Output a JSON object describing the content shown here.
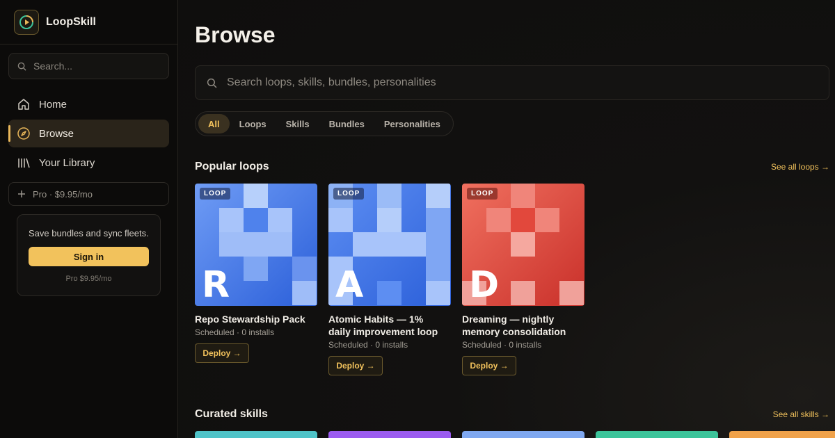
{
  "sidebar": {
    "brand": "LoopSkill",
    "search_placeholder": "Search...",
    "nav": [
      {
        "label": "Home",
        "icon": "home-icon"
      },
      {
        "label": "Browse",
        "icon": "compass-icon",
        "active": true
      },
      {
        "label": "Your Library",
        "icon": "library-icon"
      }
    ],
    "pro_pill": "Pro · $9.95/mo",
    "signin_card": {
      "text": "Save bundles and sync fleets.",
      "button": "Sign in",
      "price": "Pro $9.95/mo"
    }
  },
  "main": {
    "title": "Browse",
    "search_placeholder": "Search loops, skills, bundles, personalities",
    "filters": [
      "All",
      "Loops",
      "Skills",
      "Bundles",
      "Personalities"
    ],
    "active_filter": "All",
    "sections": {
      "popular": {
        "title": "Popular loops",
        "see_all": "See all loops →",
        "cards": [
          {
            "badge": "LOOP",
            "letter": "R",
            "title_lines": [
              "Repo Stewardship Pack"
            ],
            "meta": "Scheduled · 0 installs",
            "deploy": "Deploy →",
            "theme": "blue"
          },
          {
            "badge": "LOOP",
            "letter": "A",
            "title_lines": [
              "Atomic Habits — 1%",
              "daily improvement loop"
            ],
            "meta": "Scheduled · 0 installs",
            "deploy": "Deploy →",
            "theme": "blue"
          },
          {
            "badge": "LOOP",
            "letter": "D",
            "title_lines": [
              "Dreaming — nightly",
              "memory consolidation"
            ],
            "meta": "Scheduled · 0 installs",
            "deploy": "Deploy →",
            "theme": "red"
          }
        ]
      },
      "curated": {
        "title": "Curated skills",
        "see_all": "See all skills →"
      }
    }
  },
  "colors": {
    "accent": "#f2c25c",
    "blue_dark": "#2b5fd9",
    "blue_light": "#8db2f5",
    "red_dark": "#c9302a",
    "red_light": "#f0857a",
    "peek": [
      "#4fc3c8",
      "#9b5cf0",
      "#7fa8f0",
      "#3cc49a",
      "#f0a24a"
    ]
  }
}
